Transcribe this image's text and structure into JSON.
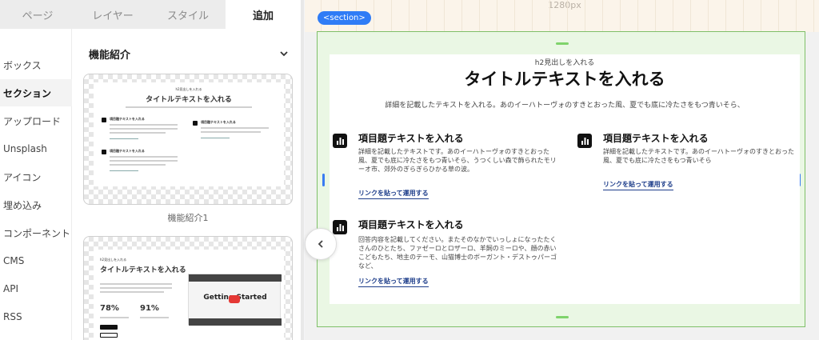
{
  "tabs": [
    {
      "label": "ページ"
    },
    {
      "label": "レイヤー"
    },
    {
      "label": "スタイル"
    },
    {
      "label": "追加"
    }
  ],
  "categories": [
    {
      "label": "ボックス"
    },
    {
      "label": "セクション"
    },
    {
      "label": "アップロード"
    },
    {
      "label": "Unsplash"
    },
    {
      "label": "アイコン"
    },
    {
      "label": "埋め込み"
    },
    {
      "label": "コンポーネント"
    },
    {
      "label": "CMS"
    },
    {
      "label": "API"
    },
    {
      "label": "RSS"
    }
  ],
  "group": {
    "title": "機能紹介"
  },
  "cards": [
    {
      "label": "機能紹介1",
      "h2": "h2見出しを入れる",
      "title": "タイトルテキストを入れる",
      "feature_title": "項目題テキストを入れる"
    },
    {
      "h2": "h2見出しを入れる",
      "title": "タイトルテキストを入れる",
      "stat1": "78%",
      "stat2": "91%",
      "video_title": "Getting Started"
    }
  ],
  "canvas": {
    "ruler_label": "1280px",
    "section_tag": "<section>",
    "h2": "h2見出しを入れる",
    "title": "タイトルテキストを入れる",
    "subtitle": "詳細を記載したテキストを入れる。あのイーハトーヴォのすきとおった風、夏でも底に冷たさをもつ青いそら、",
    "features": [
      {
        "title": "項目題テキストを入れる",
        "body": "詳細を記載したテキストです。あのイーハトーヴォのすきとおった風、夏でも底に冷たさをもつ青いそら、うつくしい森で飾られたモリーオ市、郊外のぎらぎらひかる草の波。",
        "link": "リンクを貼って運用する"
      },
      {
        "title": "項目題テキストを入れる",
        "body": "詳細を記載したテキストです。あのイーハトーヴォのすきとおった風、夏でも底に冷たさをもつ青いそら",
        "link": "リンクを貼って運用する"
      },
      {
        "title": "項目題テキストを入れる",
        "body": "回答内容を記載してください。またそのなかでいっしょになったたくさんのひとたち、ファゼーロとロザーロ、羊飼のミーロや、顔の赤いこどもたち、地主のテーモ、山猫博士のボーガント・デストゥパーゴなど、",
        "link": "リンクを貼って運用する"
      }
    ]
  },
  "colors": {
    "accent": "#2f7cf6",
    "section_border": "#7fbf68",
    "section_fill": "#eaf7e4",
    "link": "#1d3d8a"
  }
}
